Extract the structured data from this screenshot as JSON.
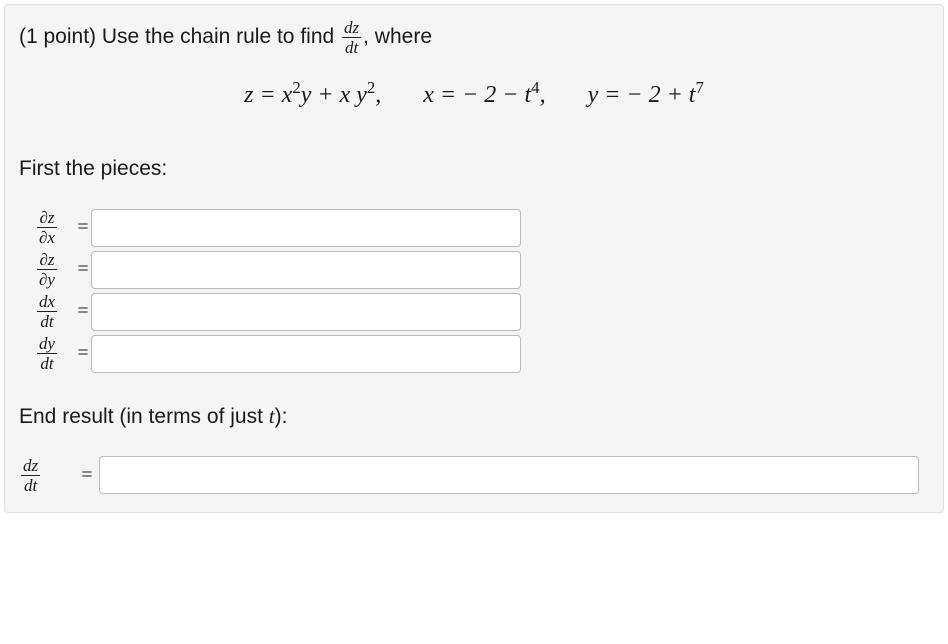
{
  "prompt": {
    "points_prefix": "(1 point) ",
    "text_before_frac": "Use the chain rule to find ",
    "frac_num": "dz",
    "frac_den": "dt",
    "text_after_frac": ", where"
  },
  "equations": {
    "z_def_html": "z = x<sup>2</sup>y + x y<sup>2</sup>,",
    "x_def_html": "x = − 2 − t<sup>4</sup>,",
    "y_def_html": "y = − 2 + t<sup>7</sup>"
  },
  "section_pieces": "First the pieces:",
  "pieces": [
    {
      "num": "∂z",
      "den": "∂x",
      "value": ""
    },
    {
      "num": "∂z",
      "den": "∂y",
      "value": ""
    },
    {
      "num": "dx",
      "den": "dt",
      "value": ""
    },
    {
      "num": "dy",
      "den": "dt",
      "value": ""
    }
  ],
  "section_end": "End result (in terms of just ",
  "section_end_var": "t",
  "section_end_tail": "):",
  "final": {
    "num": "dz",
    "den": "dt",
    "value": ""
  },
  "eq": "="
}
